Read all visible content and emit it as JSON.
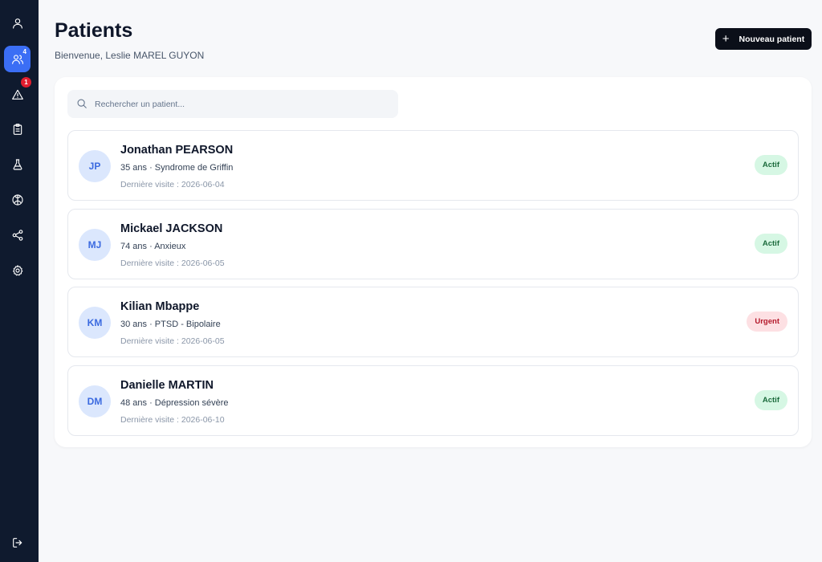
{
  "sidebar": {
    "items": [
      {
        "name": "profile",
        "icon": "user-icon",
        "badge": ""
      },
      {
        "name": "patients",
        "icon": "users-icon",
        "badge": "4",
        "active": true
      },
      {
        "name": "alerts",
        "icon": "alert-triangle-icon",
        "badge": "1"
      },
      {
        "name": "reports",
        "icon": "clipboard-icon",
        "badge": ""
      },
      {
        "name": "lab",
        "icon": "flask-icon",
        "badge": ""
      },
      {
        "name": "brain",
        "icon": "brain-icon",
        "badge": ""
      },
      {
        "name": "share",
        "icon": "share-icon",
        "badge": ""
      },
      {
        "name": "settings",
        "icon": "gear-icon",
        "badge": ""
      }
    ],
    "logout_icon": "logout-icon",
    "accent": "#3b6ef5",
    "background": "#0f1a2e"
  },
  "header": {
    "title": "Patients",
    "subtitle": "Bienvenue, Leslie MAREL GUYON",
    "new_button_label": "Nouveau patient",
    "new_button_icon": "plus-icon"
  },
  "search": {
    "placeholder": "Rechercher un patient...",
    "value": "",
    "icon": "search-icon"
  },
  "patients": [
    {
      "initials": "JP",
      "name": "Jonathan PEARSON",
      "info": "35 ans · Syndrome de Griffin",
      "last_visit": "Dernière visite : 2026-06-04",
      "status": "Actif"
    },
    {
      "initials": "MJ",
      "name": "Mickael JACKSON",
      "info": "74 ans · Anxieux",
      "last_visit": "Dernière visite : 2026-06-05",
      "status": "Actif"
    },
    {
      "initials": "KM",
      "name": "Kilian Mbappe",
      "info": "30 ans · PTSD - Bipolaire",
      "last_visit": "Dernière visite : 2026-06-05",
      "status": "Urgent"
    },
    {
      "initials": "DM",
      "name": "Danielle MARTIN",
      "info": "48 ans · Dépression sévère",
      "last_visit": "Dernière visite : 2026-06-10",
      "status": "Actif"
    }
  ],
  "colors": {
    "status_active_bg": "#d6f7e4",
    "status_active_fg": "#1b6b3c",
    "status_urgent_bg": "#fde0e3",
    "status_urgent_fg": "#b4192b",
    "badge_red": "#e11d2e"
  }
}
